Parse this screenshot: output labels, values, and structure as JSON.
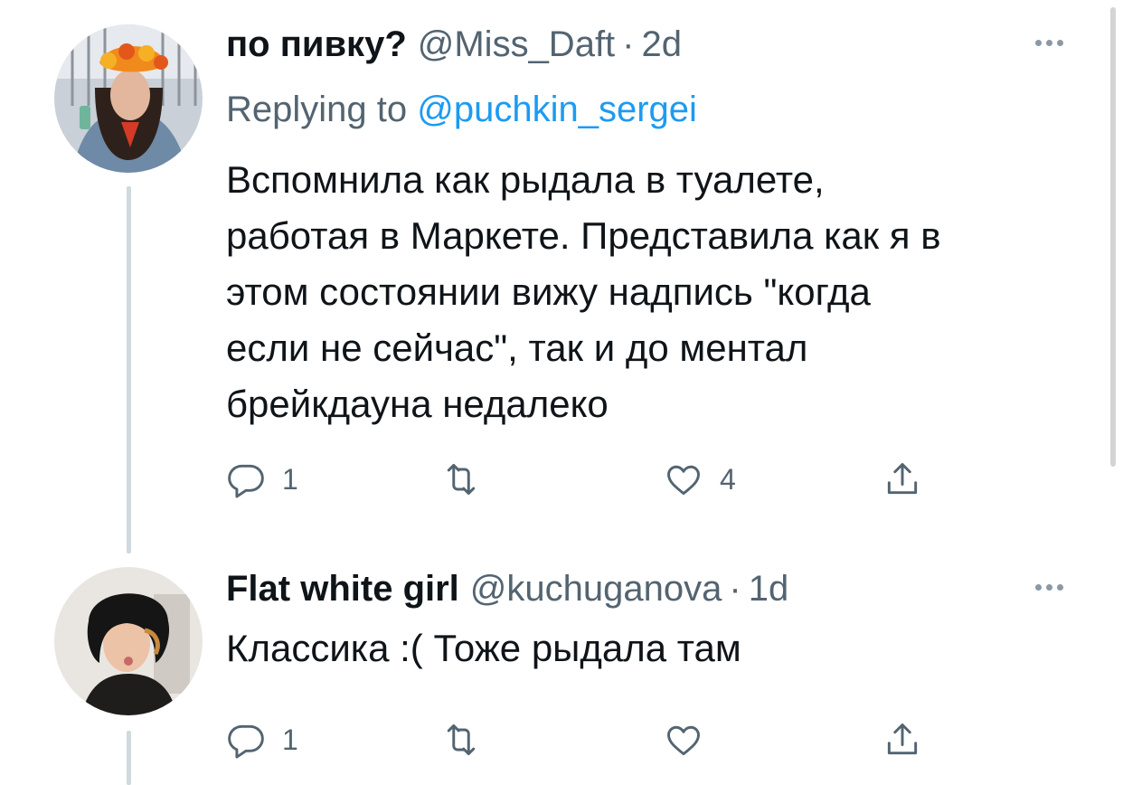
{
  "colors": {
    "accent": "#1d9bf0",
    "text_primary": "#0f1419",
    "text_secondary": "#536471",
    "thread_line": "#cfd9de"
  },
  "tweets": [
    {
      "display_name": "по пивку?",
      "handle": "@Miss_Daft",
      "separator": "·",
      "time": "2d",
      "replying_to_prefix": "Replying to",
      "replying_to_handle": "@puchkin_sergei",
      "text": "Вспомнила как рыдала в туалете,\nработая в Маркете. Представила как я в\nэтом состоянии вижу надпись \"когда\nесли не сейчас\", так и до ментал\nбрейкдауна недалеко",
      "reply_count": "1",
      "retweet_count": "",
      "like_count": "4",
      "icons": [
        "reply-icon",
        "retweet-icon",
        "like-icon",
        "share-icon",
        "more-icon"
      ]
    },
    {
      "display_name": "Flat white girl",
      "handle": "@kuchuganova",
      "separator": "·",
      "time": "1d",
      "text": "Классика :( Тоже рыдала там",
      "reply_count": "1",
      "retweet_count": "",
      "like_count": "",
      "icons": [
        "reply-icon",
        "retweet-icon",
        "like-icon",
        "share-icon",
        "more-icon"
      ]
    }
  ]
}
